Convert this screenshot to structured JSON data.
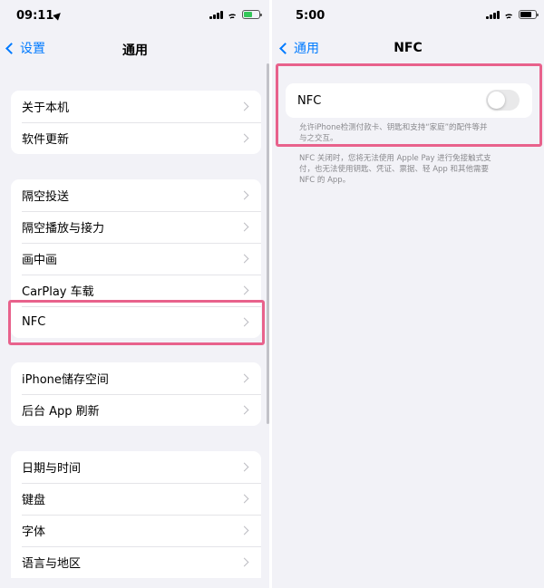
{
  "left": {
    "status": {
      "time": "09:11",
      "battery_color": "#34c759"
    },
    "nav": {
      "back_label": "设置",
      "title": "通用"
    },
    "groups": [
      {
        "items": [
          {
            "label": "关于本机"
          },
          {
            "label": "软件更新"
          }
        ]
      },
      {
        "items": [
          {
            "label": "隔空投送"
          },
          {
            "label": "隔空播放与接力"
          },
          {
            "label": "画中画"
          },
          {
            "label": "CarPlay 车载"
          },
          {
            "label": "NFC"
          }
        ]
      },
      {
        "items": [
          {
            "label": "iPhone储存空间"
          },
          {
            "label": "后台 App 刷新"
          }
        ]
      },
      {
        "items": [
          {
            "label": "日期与时间"
          },
          {
            "label": "键盘"
          },
          {
            "label": "字体"
          },
          {
            "label": "语言与地区"
          }
        ]
      }
    ]
  },
  "right": {
    "status": {
      "time": "5:00",
      "battery_color": "#000000"
    },
    "nav": {
      "back_label": "通用",
      "title": "NFC"
    },
    "nfc": {
      "label": "NFC",
      "enabled": false
    },
    "footer_1": {
      "line1": "允许iPhone检测付款卡、钥匙和支持“家庭”的配件等并",
      "line2": "与之交互。"
    },
    "footer_2": {
      "line1": "NFC 关闭时，您将无法使用 Apple Pay 进行免接触式支",
      "line2": "付，也无法使用钥匙、凭证、票据、轻 App 和其他需要",
      "line3": "NFC 的 App。"
    }
  },
  "colors": {
    "accent": "#007aff",
    "highlight": "#e8628c",
    "background": "#f2f2f7"
  }
}
